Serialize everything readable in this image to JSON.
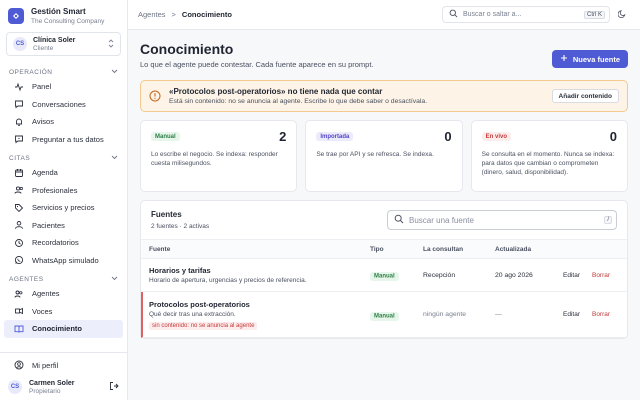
{
  "brand": {
    "name": "Gestión Smart",
    "subtitle": "The Consulting Company"
  },
  "client": {
    "initials": "CS",
    "name": "Clínica Soler",
    "role": "Cliente"
  },
  "sidebar": {
    "sections": [
      {
        "label": "OPERACIÓN",
        "items": [
          {
            "label": "Panel",
            "icon": "activity-icon"
          },
          {
            "label": "Conversaciones",
            "icon": "chat-icon"
          },
          {
            "label": "Avisos",
            "icon": "bell-icon"
          },
          {
            "label": "Preguntar a tus datos",
            "icon": "question-icon"
          }
        ]
      },
      {
        "label": "CITAS",
        "items": [
          {
            "label": "Agenda",
            "icon": "calendar-icon"
          },
          {
            "label": "Profesionales",
            "icon": "users-icon"
          },
          {
            "label": "Servicios y precios",
            "icon": "tag-icon"
          },
          {
            "label": "Pacientes",
            "icon": "user-group-icon"
          },
          {
            "label": "Recordatorios",
            "icon": "clock-bell-icon"
          },
          {
            "label": "WhatsApp simulado",
            "icon": "whatsapp-icon"
          }
        ]
      },
      {
        "label": "AGENTES",
        "items": [
          {
            "label": "Agentes",
            "icon": "bot-icon"
          },
          {
            "label": "Voces",
            "icon": "mic-icon"
          },
          {
            "label": "Conocimiento",
            "icon": "book-icon",
            "active": true
          }
        ]
      }
    ],
    "profile_label": "Mi perfil"
  },
  "user": {
    "initials": "CS",
    "name": "Carmen Soler",
    "role": "Propietario"
  },
  "topbar": {
    "breadcrumb": [
      "Agentes",
      "Conocimiento"
    ],
    "breadcrumb_sep": ">",
    "search_placeholder": "Buscar o saltar a...",
    "search_shortcut": "Ctrl K"
  },
  "page": {
    "title": "Conocimiento",
    "subtitle": "Lo que el agente puede contestar. Cada fuente aparece en su prompt.",
    "primary_button": "Nueva fuente"
  },
  "alert": {
    "title": "«Protocolos post-operatorios» no tiene nada que contar",
    "description": "Está sin contenido: no se anuncia al agente. Escribe lo que debe saber o desactívala.",
    "button": "Añadir contenido",
    "color": "#f2c98f"
  },
  "cards": [
    {
      "badge": "Manual",
      "kind": "manual",
      "count": "2",
      "description": "Lo escribe el negocio. Se indexa: responder cuesta milisegundos."
    },
    {
      "badge": "Importada",
      "kind": "import",
      "count": "0",
      "description": "Se trae por API y se refresca. Se indexa."
    },
    {
      "badge": "En vivo",
      "kind": "live",
      "count": "0",
      "description": "Se consulta en el momento. Nunca se indexa: para datos que cambian o comprometen (dinero, salud, disponibilidad)."
    }
  ],
  "sources": {
    "title": "Fuentes",
    "summary": "2 fuentes · 2 activas",
    "search_placeholder": "Buscar una fuente",
    "search_shortcut": "/",
    "columns": [
      "Fuente",
      "Tipo",
      "La consultan",
      "Actualizada"
    ],
    "rows": [
      {
        "name": "Horarios y tarifas",
        "description": "Horario de apertura, urgencias y precios de referencia.",
        "type": "Manual",
        "consumers": "Recepción",
        "updated": "20 ago 2026",
        "flag": "",
        "edit": "Editar",
        "delete": "Borrar"
      },
      {
        "name": "Protocolos post-operatorios",
        "description": "Qué decir tras una extracción.",
        "type": "Manual",
        "consumers": "ningún agente",
        "updated": "—",
        "flag": "sin contenido: no se anuncia al agente",
        "edit": "Editar",
        "delete": "Borrar"
      }
    ]
  },
  "colors": {
    "accent": "#4f5bd5",
    "danger": "#c33b3b",
    "success": "#2e7d46"
  }
}
